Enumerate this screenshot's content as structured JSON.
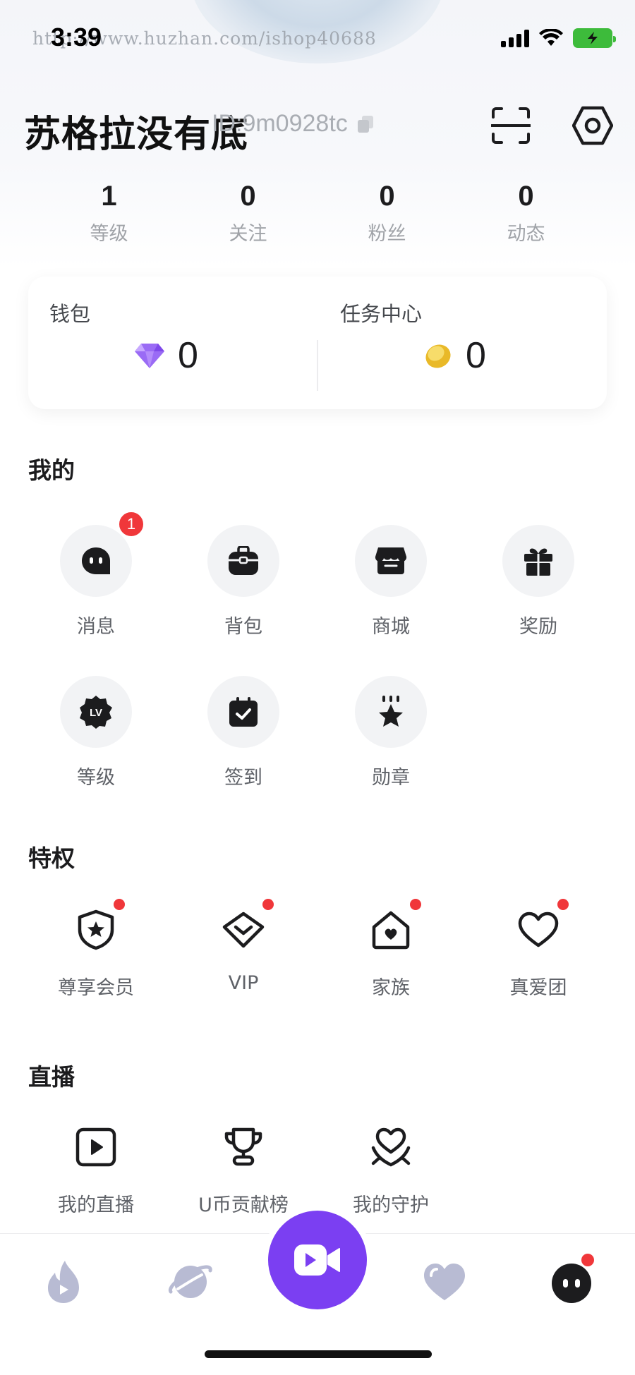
{
  "status_bar": {
    "time": "3:39",
    "watermark": "http://www.huzhan.com/ishop40688"
  },
  "profile": {
    "name": "苏格拉没有底",
    "id_text": "ID:9m0928tc"
  },
  "stats": [
    {
      "value": "1",
      "label": "等级"
    },
    {
      "value": "0",
      "label": "关注"
    },
    {
      "value": "0",
      "label": "粉丝"
    },
    {
      "value": "0",
      "label": "动态"
    }
  ],
  "wallet": {
    "title": "钱包",
    "diamond_value": "0",
    "task_title": "任务中心",
    "coin_value": "0"
  },
  "my_section": {
    "title": "我的",
    "items": [
      {
        "label": "消息",
        "icon": "message-icon",
        "badge": "1"
      },
      {
        "label": "背包",
        "icon": "backpack-icon"
      },
      {
        "label": "商城",
        "icon": "store-icon"
      },
      {
        "label": "奖励",
        "icon": "gift-icon"
      },
      {
        "label": "等级",
        "icon": "level-icon"
      },
      {
        "label": "签到",
        "icon": "calendar-check-icon"
      },
      {
        "label": "勋章",
        "icon": "medal-icon"
      }
    ]
  },
  "privilege_section": {
    "title": "特权",
    "items": [
      {
        "label": "尊享会员",
        "icon": "shield-star-icon"
      },
      {
        "label": "VIP",
        "icon": "vip-diamond-icon"
      },
      {
        "label": "家族",
        "icon": "family-house-icon"
      },
      {
        "label": "真爱团",
        "icon": "heart-icon"
      }
    ]
  },
  "live_section": {
    "title": "直播",
    "items": [
      {
        "label": "我的直播",
        "icon": "play-icon"
      },
      {
        "label": "U币贡献榜",
        "icon": "trophy-icon"
      },
      {
        "label": "我的守护",
        "icon": "guard-heart-icon"
      }
    ]
  },
  "bottom_nav": {
    "items": [
      "flame-play-icon",
      "planet-icon",
      "video-camera-icon",
      "heart-nav-icon",
      "profile-face-icon"
    ]
  },
  "colors": {
    "accent": "#7b3ff2",
    "badge_red": "#f0373a",
    "battery_green": "#3dbb3b"
  }
}
